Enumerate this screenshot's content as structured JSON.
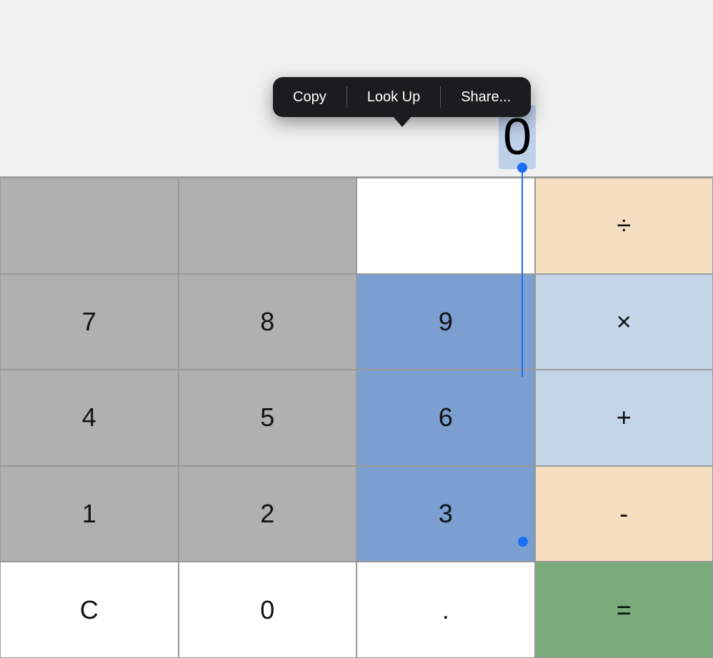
{
  "contextMenu": {
    "copy": "Copy",
    "lookUp": "Look Up",
    "share": "Share..."
  },
  "display": {
    "value": "0",
    "selectedDigit": "0"
  },
  "keys": {
    "row1": [
      "7",
      "8",
      "9",
      "×"
    ],
    "row2": [
      "4",
      "5",
      "6",
      "+"
    ],
    "row3": [
      "1",
      "2",
      "3",
      "-"
    ],
    "row4": [
      "C",
      "0",
      ".",
      "="
    ],
    "operators": [
      "÷",
      "×",
      "+",
      "-",
      "="
    ]
  },
  "colors": {
    "gray": "#b2b2b2",
    "lightGray": "#c8c8c8",
    "white": "#ffffff",
    "operator": "#f5dfc0",
    "operatorBlue": "#c5d5e8",
    "equals": "#7aaa7a",
    "selected": "#7a9fd0",
    "menuBg": "#1c1c1e",
    "menuText": "#ffffff"
  }
}
